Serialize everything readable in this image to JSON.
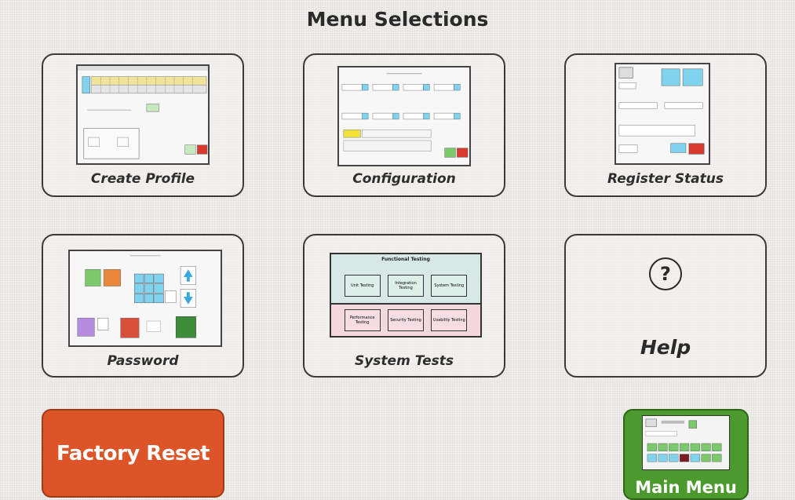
{
  "header": {
    "title": "Menu Selections"
  },
  "tiles": [
    {
      "label": "Create Profile",
      "icon": "create-profile-screen-thumbnail"
    },
    {
      "label": "Configuration",
      "icon": "configuration-screen-thumbnail"
    },
    {
      "label": "Register Status",
      "icon": "register-status-screen-thumbnail"
    },
    {
      "label": "Password",
      "icon": "password-keypad-screen-thumbnail"
    },
    {
      "label": "System Tests",
      "icon": "system-tests-diagram-thumbnail"
    },
    {
      "label": "Help",
      "icon": "question-mark-icon",
      "glyph": "?"
    }
  ],
  "system_tests_thumb": {
    "header": "Functional Testing",
    "top_boxes": [
      "Unit Testing",
      "Integration Testing",
      "System Testing"
    ],
    "bottom_boxes": [
      "Performance Testing",
      "Security Testing",
      "Usability Testing"
    ]
  },
  "buttons": {
    "factory_reset": "Factory Reset",
    "main_menu": "Main Menu"
  },
  "colors": {
    "background": "#efeeea",
    "factory_reset": "#dc5427",
    "main_menu": "#4c9a2e",
    "thumb_accent_cyan": "#7fd3ee",
    "thumb_accent_red": "#d93a2f",
    "thumb_accent_green": "#7bc96a",
    "tests_top_fill": "#d6e9e6",
    "tests_bottom_fill": "#f3d8dd"
  }
}
